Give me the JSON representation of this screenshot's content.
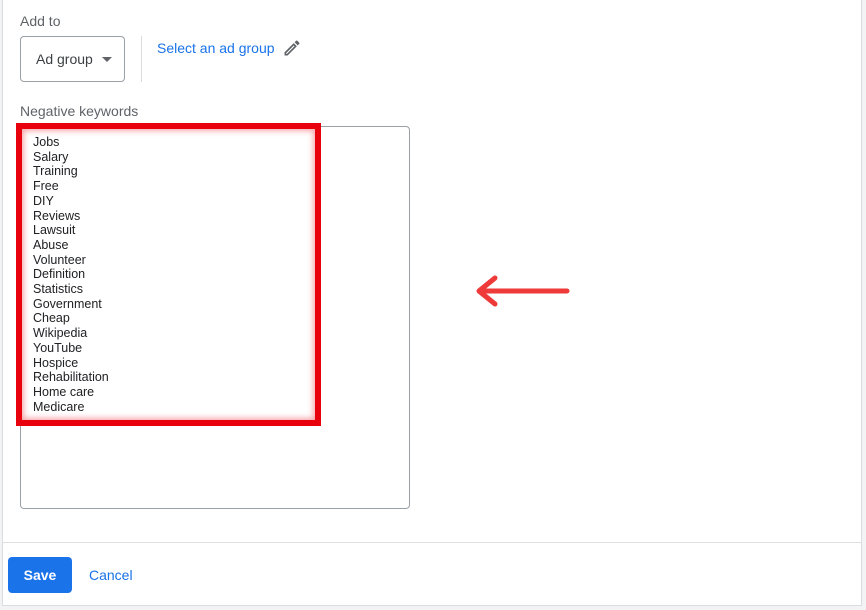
{
  "add_to": {
    "label": "Add to",
    "selector_value": "Ad group",
    "select_link": "Select an ad group"
  },
  "negative_keywords": {
    "label": "Negative keywords",
    "items": [
      "Jobs",
      "Salary",
      "Training",
      "Free",
      "DIY",
      "Reviews",
      "Lawsuit",
      "Abuse",
      "Volunteer",
      "Definition",
      "Statistics",
      "Government",
      "Cheap",
      "Wikipedia",
      "YouTube",
      "Hospice",
      "Rehabilitation",
      "Home care",
      "Medicare"
    ]
  },
  "footer": {
    "save_label": "Save",
    "cancel_label": "Cancel"
  },
  "colors": {
    "accent": "#1a73e8",
    "annotation_red": "#e8000d",
    "arrow_red": "#ef3a3a"
  },
  "icons": {
    "dropdown": "caret-down-icon",
    "edit": "pencil-icon",
    "annotation": "left-arrow-icon"
  }
}
